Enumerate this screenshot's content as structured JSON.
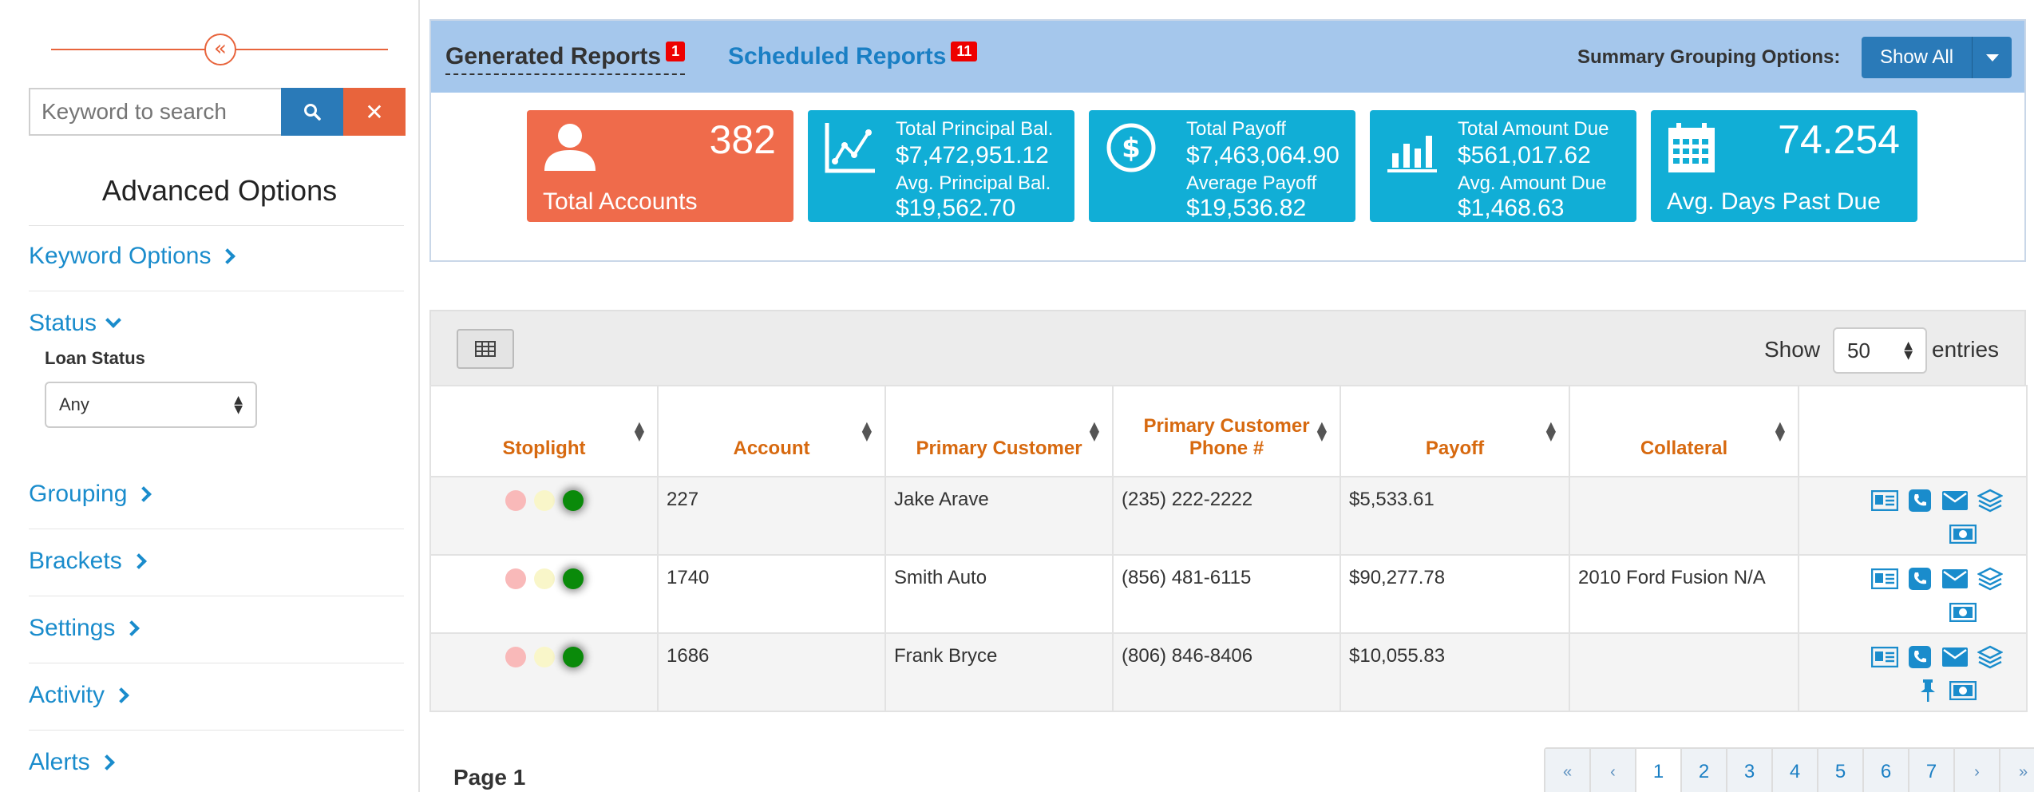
{
  "sidebar": {
    "search": {
      "placeholder": "Keyword to search"
    },
    "advanced_title": "Advanced Options",
    "links": {
      "keyword_options": "Keyword Options",
      "status": "Status",
      "grouping": "Grouping",
      "brackets": "Brackets",
      "settings": "Settings",
      "activity": "Activity",
      "alerts": "Alerts"
    },
    "loan_status": {
      "label": "Loan Status",
      "value": "Any"
    }
  },
  "reports": {
    "generated": {
      "label": "Generated Reports",
      "count": "1"
    },
    "scheduled": {
      "label": "Scheduled Reports",
      "count": "11"
    },
    "grouping_label": "Summary Grouping Options:",
    "grouping_value": "Show All"
  },
  "cards": {
    "accounts": {
      "value": "382",
      "label": "Total Accounts"
    },
    "principal": {
      "label1": "Total Principal Bal.",
      "value1": "$7,472,951.12",
      "label2": "Avg. Principal Bal.",
      "value2": "$19,562.70"
    },
    "payoff": {
      "label1": "Total Payoff",
      "value1": "$7,463,064.90",
      "label2": "Average Payoff",
      "value2": "$19,536.82"
    },
    "amount_due": {
      "label1": "Total Amount Due",
      "value1": "$561,017.62",
      "label2": "Avg. Amount Due",
      "value2": "$1,468.63"
    },
    "days_past_due": {
      "value": "74.254",
      "label": "Avg. Days Past Due"
    }
  },
  "table": {
    "show_label": "Show",
    "entries_value": "50",
    "entries_label": "entries",
    "headers": {
      "stoplight": "Stoplight",
      "account": "Account",
      "primary_customer": "Primary Customer",
      "phone_line1": "Primary Customer",
      "phone_line2": "Phone #",
      "payoff": "Payoff",
      "collateral": "Collateral"
    },
    "rows": [
      {
        "account": "227",
        "customer": "Jake Arave",
        "phone": "(235) 222-2222",
        "payoff": "$5,533.61",
        "collateral": ""
      },
      {
        "account": "1740",
        "customer": "Smith Auto",
        "phone": "(856) 481-6115",
        "payoff": "$90,277.78",
        "collateral": "2010 Ford Fusion N/A"
      },
      {
        "account": "1686",
        "customer": "Frank Bryce",
        "phone": "(806) 846-8406",
        "payoff": "$10,055.83",
        "collateral": ""
      }
    ]
  },
  "pagination": {
    "page_label": "Page 1",
    "first": "«",
    "prev": "‹",
    "pages": [
      "1",
      "2",
      "3",
      "4",
      "5",
      "6",
      "7"
    ],
    "next": "›",
    "last": "»"
  },
  "colors": {
    "accent_orange": "#ef6b4b",
    "accent_blue": "#11aed6",
    "link_blue": "#1a8ccc",
    "header_orange": "#d7690f"
  }
}
